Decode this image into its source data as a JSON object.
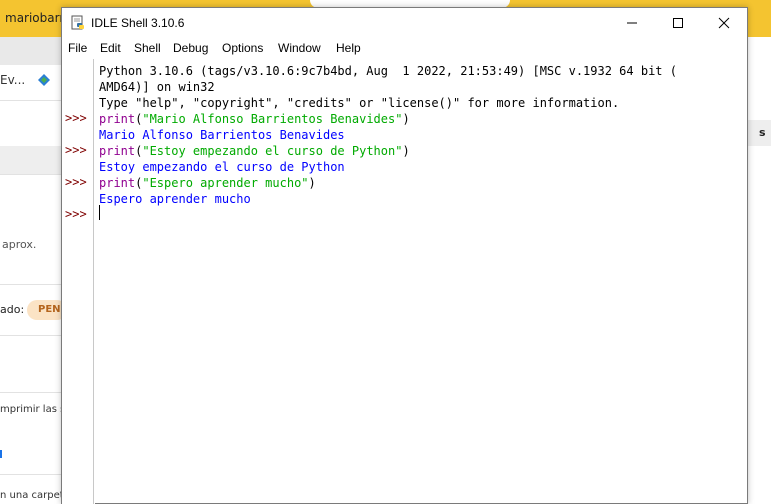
{
  "background": {
    "browser_tab_label": "mariobarri",
    "sidebar_item_label": "Ev...",
    "aprox_text": "aprox.",
    "status_label": "ado:",
    "status_badge": "PEN",
    "imprimir_text": "mprimir las s",
    "carpeta_text": "n una carpet",
    "right_edge_text": "s",
    "accent_color": "#f4c430"
  },
  "window": {
    "title": "IDLE Shell 3.10.6",
    "icon": "python-idle-icon",
    "controls": [
      "minimize-icon",
      "maximize-icon",
      "close-icon"
    ]
  },
  "menu": {
    "items": [
      "File",
      "Edit",
      "Shell",
      "Debug",
      "Options",
      "Window",
      "Help"
    ]
  },
  "shell": {
    "prompt": ">>>",
    "banner_line1": "Python 3.10.6 (tags/v3.10.6:9c7b4bd, Aug  1 2022, 21:53:49) [MSC v.1932 64 bit (",
    "banner_line2": "AMD64)] on win32",
    "banner_line3": "Type \"help\", \"copyright\", \"credits\" or \"license()\" for more information.",
    "commands": [
      {
        "keyword": "print",
        "open": "(",
        "string": "\"Mario Alfonso Barrientos Benavides\"",
        "close": ")",
        "output": "Mario Alfonso Barrientos Benavides"
      },
      {
        "keyword": "print",
        "open": "(",
        "string": "\"Estoy empezando el curso de Python\"",
        "close": ")",
        "output": "Estoy empezando el curso de Python"
      },
      {
        "keyword": "print",
        "open": "(",
        "string": "\"Espero aprender mucho\"",
        "close": ")",
        "output": "Espero aprender mucho"
      }
    ]
  },
  "colors": {
    "prompt": "#7f0000",
    "keyword": "#900090",
    "string": "#00aa00",
    "output": "#0000ff"
  }
}
